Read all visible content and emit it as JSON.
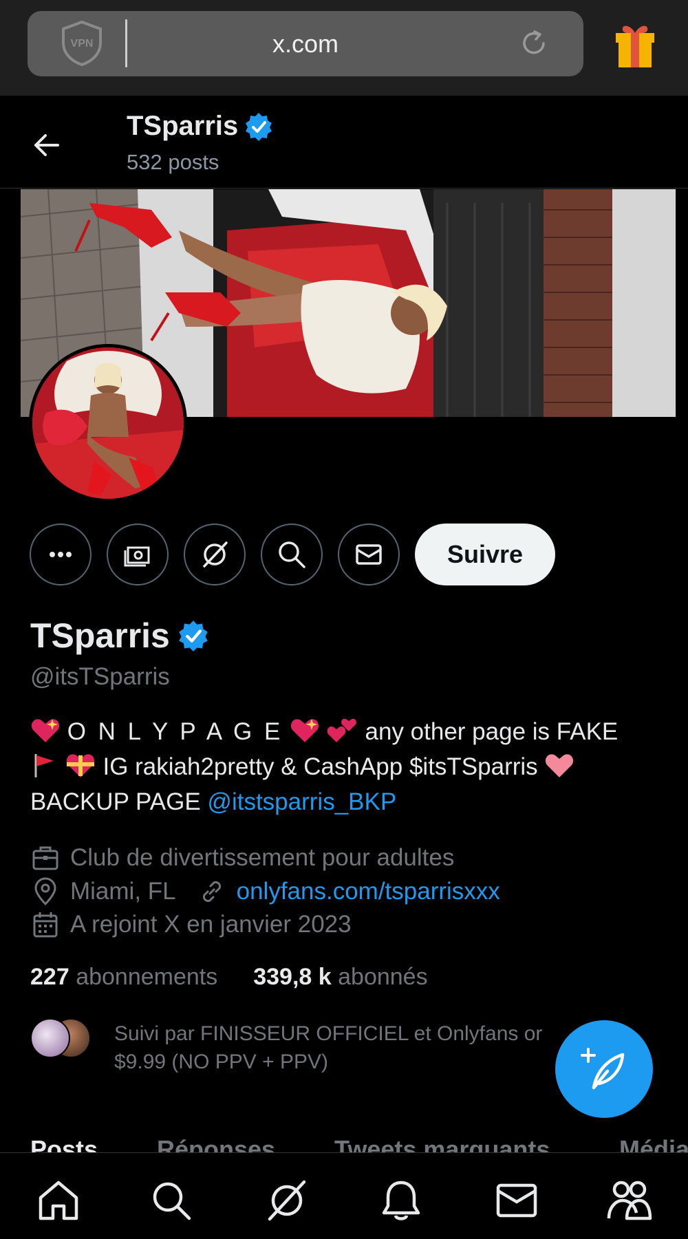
{
  "browser": {
    "url": "x.com",
    "vpn_label": "VPN"
  },
  "header": {
    "title": "TSparris",
    "posts_count": "532 posts"
  },
  "actions": {
    "follow_label": "Suivre"
  },
  "profile": {
    "name": "TSparris",
    "handle": "@itsTSparris",
    "bio": {
      "line1_text": "O N L Y  P A G E",
      "line1_tail": "any other page is FAKE",
      "line2_text": "IG rakiah2pretty & CashApp $itsTSparris",
      "line3_text": "BACKUP PAGE",
      "line3_link": "@itstsparris_BKP"
    },
    "category": "Club de divertissement pour adultes",
    "location": "Miami, FL",
    "website": "onlyfans.com/tsparrisxxx",
    "joined": "A rejoint X en janvier 2023",
    "following_count": "227",
    "following_label": "abonnements",
    "followers_count": "339,8 k",
    "followers_label": "abonnés",
    "followed_by_line1": "Suivi par FINISSEUR OFFICIEL et Onlyfans or",
    "followed_by_line2": "$9.99 (NO PPV + PPV)"
  },
  "tabs": [
    "Posts",
    "Réponses",
    "Tweets marquants",
    "Média"
  ],
  "colors": {
    "accent": "#1d9bf0",
    "background": "#000000",
    "secondary_text": "#71767b"
  },
  "icons": {
    "bottom_nav": [
      "home-icon",
      "search-icon",
      "grok-icon",
      "notifications-icon",
      "messages-icon",
      "communities-icon"
    ]
  }
}
